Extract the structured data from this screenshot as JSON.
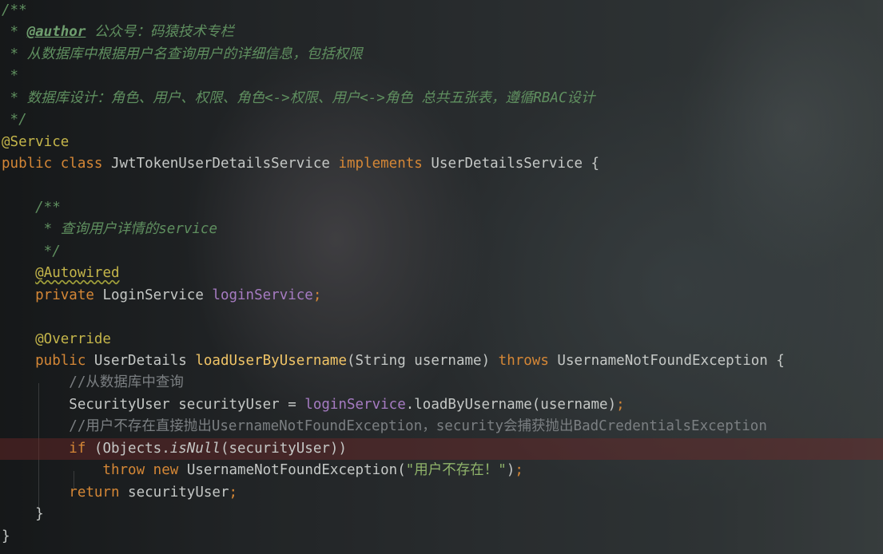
{
  "editor": {
    "lines": [
      [
        {
          "t": "/**",
          "c": "comment"
        }
      ],
      [
        {
          "t": " * ",
          "c": "comment"
        },
        {
          "t": "@author",
          "c": "tag"
        },
        {
          "t": " 公众号：码猿技术专栏",
          "c": "comment"
        }
      ],
      [
        {
          "t": " * 从数据库中根据用户名查询用户的详细信息，包括权限",
          "c": "comment"
        }
      ],
      [
        {
          "t": " *",
          "c": "comment"
        }
      ],
      [
        {
          "t": " * 数据库设计：角色、用户、权限、角色<->权限、用户<->角色 总共五张表，遵循RBAC设计",
          "c": "comment"
        }
      ],
      [
        {
          "t": " */",
          "c": "comment"
        }
      ],
      [
        {
          "t": "@Service",
          "c": "anno"
        }
      ],
      [
        {
          "t": "public ",
          "c": "kw"
        },
        {
          "t": "class ",
          "c": "kw"
        },
        {
          "t": "JwtTokenUserDetailsService ",
          "c": "ident"
        },
        {
          "t": "implements ",
          "c": "kw"
        },
        {
          "t": "UserDetailsService {",
          "c": "ident"
        }
      ],
      [
        {
          "t": "",
          "c": "ident"
        }
      ],
      [
        {
          "t": "    /**",
          "c": "comment"
        }
      ],
      [
        {
          "t": "     * 查询用户详情的service",
          "c": "comment"
        }
      ],
      [
        {
          "t": "     */",
          "c": "comment"
        }
      ],
      [
        {
          "t": "    ",
          "c": "ident"
        },
        {
          "t": "@Autowired",
          "c": "anno-warn"
        }
      ],
      [
        {
          "t": "    private ",
          "c": "kw"
        },
        {
          "t": "LoginService ",
          "c": "ident"
        },
        {
          "t": "loginService",
          "c": "field"
        },
        {
          "t": ";",
          "c": "semi"
        }
      ],
      [
        {
          "t": "",
          "c": "ident"
        }
      ],
      [
        {
          "t": "    @Override",
          "c": "anno"
        }
      ],
      [
        {
          "t": "    public ",
          "c": "kw"
        },
        {
          "t": "UserDetails ",
          "c": "ident"
        },
        {
          "t": "loadUserByUsername",
          "c": "method"
        },
        {
          "t": "(String username) ",
          "c": "ident"
        },
        {
          "t": "throws ",
          "c": "kw"
        },
        {
          "t": "UsernameNotFoundException {",
          "c": "ident"
        }
      ],
      [
        {
          "t": "        //从数据库中查询",
          "c": "line-comment"
        }
      ],
      [
        {
          "t": "        SecurityUser securityUser = ",
          "c": "ident"
        },
        {
          "t": "loginService",
          "c": "field"
        },
        {
          "t": ".loadByUsername(username)",
          "c": "ident"
        },
        {
          "t": ";",
          "c": "semi"
        }
      ],
      [
        {
          "t": "        //用户不存在直接抛出UsernameNotFoundException，security会捕获抛出BadCredentialsException",
          "c": "line-comment"
        }
      ],
      [
        {
          "t": "        if ",
          "c": "kw"
        },
        {
          "t": "(Objects.",
          "c": "ident"
        },
        {
          "t": "isNull",
          "c": "static"
        },
        {
          "t": "(securityUser))",
          "c": "ident"
        }
      ],
      [
        {
          "t": "            throw ",
          "c": "kw"
        },
        {
          "t": "new ",
          "c": "kw"
        },
        {
          "t": "UsernameNotFoundException(",
          "c": "ident"
        },
        {
          "t": "\"用户不存在！\"",
          "c": "str"
        },
        {
          "t": ")",
          "c": "ident"
        },
        {
          "t": ";",
          "c": "semi"
        }
      ],
      [
        {
          "t": "        return ",
          "c": "kw"
        },
        {
          "t": "securityUser",
          "c": "ident"
        },
        {
          "t": ";",
          "c": "semi"
        }
      ],
      [
        {
          "t": "    }",
          "c": "ident"
        }
      ],
      [
        {
          "t": "}",
          "c": "ident"
        }
      ]
    ],
    "highlighted_line": 20
  }
}
